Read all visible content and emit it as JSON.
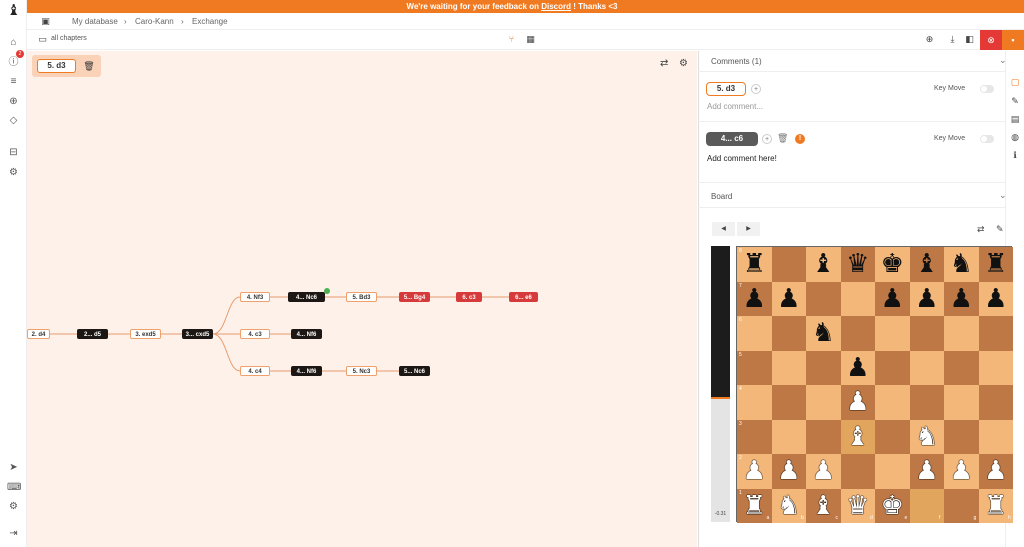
{
  "banner": {
    "prefix": "We're waiting for your feedback on ",
    "link": "Discord",
    "suffix": " ! Thanks <3"
  },
  "breadcrumb": {
    "db": "My database",
    "opening": "Caro-Kann",
    "variation": "Exchange"
  },
  "toolbar": {
    "chapters_label": "all chapters"
  },
  "sidebar": {
    "notification_count": "2"
  },
  "selected_move": "5.   d3",
  "tree": {
    "nodes": [
      {
        "label": "2. d4",
        "color": "white"
      },
      {
        "label": "2... d5",
        "color": "black"
      },
      {
        "label": "3. exd5",
        "color": "white"
      },
      {
        "label": "3... cxd5",
        "color": "black"
      },
      {
        "label": "4. Nf3",
        "color": "white"
      },
      {
        "label": "4... Nc6",
        "color": "black"
      },
      {
        "label": "5. Bd3",
        "color": "white"
      },
      {
        "label": "5... Bg4",
        "color": "red"
      },
      {
        "label": "6. c3",
        "color": "red"
      },
      {
        "label": "6... e6",
        "color": "red"
      },
      {
        "label": "4. c3",
        "color": "white"
      },
      {
        "label": "4... Nf6",
        "color": "black"
      },
      {
        "label": "4. c4",
        "color": "white"
      },
      {
        "label": "4... Nf6",
        "color": "black"
      },
      {
        "label": "5. Nc3",
        "color": "white"
      },
      {
        "label": "5... Nc6",
        "color": "black"
      }
    ]
  },
  "comments": {
    "header": "Comments (1)",
    "entries": [
      {
        "move": "5.   d3",
        "key_move_label": "Key Move",
        "placeholder": "Add comment...",
        "text": ""
      },
      {
        "move": "4...   c6",
        "key_move_label": "Key Move",
        "placeholder": "",
        "text": "Add comment here!"
      }
    ]
  },
  "board_section": {
    "header": "Board",
    "eval": "-0.31",
    "eval_fraction": 0.55
  },
  "board": {
    "files": [
      "a",
      "b",
      "c",
      "d",
      "e",
      "f",
      "g",
      "h"
    ],
    "ranks": [
      "8",
      "7",
      "6",
      "5",
      "4",
      "3",
      "2",
      "1"
    ],
    "position": [
      [
        "bR",
        "",
        "bB",
        "bQ",
        "bK",
        "bB",
        "bN",
        "bR"
      ],
      [
        "bP",
        "bP",
        "",
        "",
        "bP",
        "bP",
        "bP",
        "bP"
      ],
      [
        "",
        "",
        "bN",
        "",
        "",
        "",
        "",
        ""
      ],
      [
        "",
        "",
        "",
        "bP",
        "",
        "",
        "",
        ""
      ],
      [
        "",
        "",
        "",
        "wP",
        "",
        "",
        "",
        ""
      ],
      [
        "",
        "",
        "",
        "wB",
        "",
        "wN",
        "",
        ""
      ],
      [
        "wP",
        "wP",
        "wP",
        "",
        "",
        "wP",
        "wP",
        "wP"
      ],
      [
        "wR",
        "wN",
        "wB",
        "wQ",
        "wK",
        "",
        "",
        "wR"
      ]
    ],
    "highlight": [
      "f1",
      "d3"
    ]
  },
  "colors": {
    "accent": "#f07a22",
    "red": "#d63a3a",
    "light": "#f2b779",
    "dark": "#bd7845"
  }
}
